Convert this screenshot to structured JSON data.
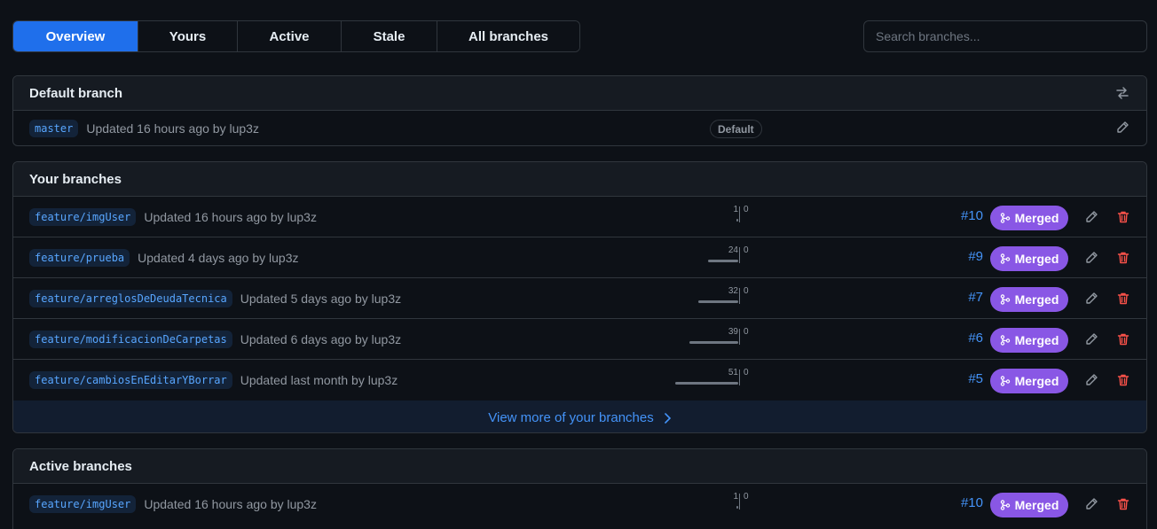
{
  "tabs": [
    {
      "label": "Overview",
      "selected": true
    },
    {
      "label": "Yours",
      "selected": false
    },
    {
      "label": "Active",
      "selected": false
    },
    {
      "label": "Stale",
      "selected": false
    },
    {
      "label": "All branches",
      "selected": false
    }
  ],
  "search": {
    "placeholder": "Search branches..."
  },
  "default_section": {
    "title": "Default branch",
    "branch": {
      "name": "master",
      "updated": "Updated 16 hours ago by lup3z",
      "badge": "Default"
    }
  },
  "your_section": {
    "title": "Your branches",
    "branches": [
      {
        "name": "feature/imgUser",
        "updated": "Updated 16 hours ago by lup3z",
        "behind": "1",
        "ahead": "0",
        "pr": "#10",
        "status": "Merged"
      },
      {
        "name": "feature/prueba",
        "updated": "Updated 4 days ago by lup3z",
        "behind": "24",
        "ahead": "0",
        "pr": "#9",
        "status": "Merged"
      },
      {
        "name": "feature/arreglosDeDeudaTecnica",
        "updated": "Updated 5 days ago by lup3z",
        "behind": "32",
        "ahead": "0",
        "pr": "#7",
        "status": "Merged"
      },
      {
        "name": "feature/modificacionDeCarpetas",
        "updated": "Updated 6 days ago by lup3z",
        "behind": "39",
        "ahead": "0",
        "pr": "#6",
        "status": "Merged"
      },
      {
        "name": "feature/cambiosEnEditarYBorrar",
        "updated": "Updated last month by lup3z",
        "behind": "51",
        "ahead": "0",
        "pr": "#5",
        "status": "Merged"
      }
    ],
    "view_more": "View more of your branches"
  },
  "active_section": {
    "title": "Active branches",
    "branches": [
      {
        "name": "feature/imgUser",
        "updated": "Updated 16 hours ago by lup3z",
        "behind": "1",
        "ahead": "0",
        "pr": "#10",
        "status": "Merged"
      }
    ]
  },
  "colors": {
    "accent": "#1f6feb",
    "merged": "#8957e5",
    "delete": "#f85149",
    "link": "#4493f8"
  }
}
